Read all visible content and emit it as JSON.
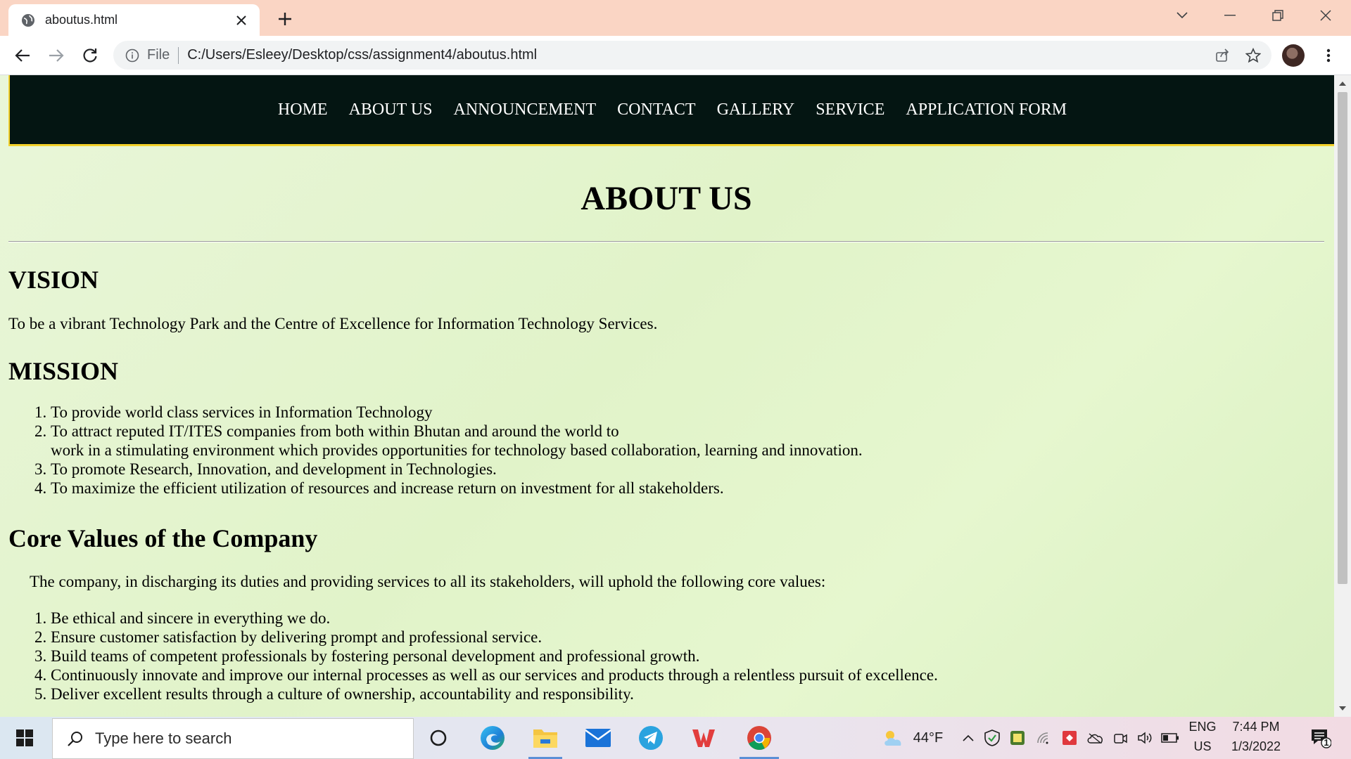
{
  "browser": {
    "tab_title": "aboutus.html",
    "scheme_label": "File",
    "url": "C:/Users/Esleey/Desktop/css/assignment4/aboutus.html"
  },
  "site": {
    "nav": [
      "HOME",
      "ABOUT US",
      "ANNOUNCEMENT",
      "CONTACT",
      "GALLERY",
      "SERVICE",
      "APPLICATION FORM"
    ],
    "page_title": "ABOUT US",
    "vision": {
      "heading": "VISION",
      "text": "To be a vibrant Technology Park and the Centre of Excellence for Information Technology Services."
    },
    "mission": {
      "heading": "MISSION",
      "items": [
        "To provide world class services in Information Technology",
        "To attract reputed IT/ITES companies from both within Bhutan and around the world to",
        "To promote Research, Innovation, and development in Technologies.",
        "To maximize the efficient utilization of resources and increase return on investment for all stakeholders."
      ],
      "item2_cont": "work in a stimulating environment which provides opportunities for technology based collaboration, learning and innovation."
    },
    "core_values": {
      "heading": "Core Values of the Company",
      "intro": "The company, in discharging its duties and providing services to all its stakeholders, will uphold the following core values:",
      "items": [
        "Be ethical and sincere in everything we do.",
        "Ensure customer satisfaction by delivering prompt and professional service.",
        "Build teams of competent professionals by fostering personal development and professional growth.",
        "Continuously innovate and improve our internal processes as well as our services and products through a relentless pursuit of excellence.",
        "Deliver excellent results through a culture of ownership, accountability and responsibility."
      ]
    }
  },
  "taskbar": {
    "search_placeholder": "Type here to search",
    "weather_temp": "44°F",
    "lang_top": "ENG",
    "lang_bottom": "US",
    "time": "7:44 PM",
    "date": "1/3/2022",
    "notification_count": "1"
  },
  "colors": {
    "nav_bg": "#041512",
    "nav_border": "#f3d12a",
    "page_bg": "#e1f3c9",
    "tabbar_bg": "#fad5c4"
  }
}
